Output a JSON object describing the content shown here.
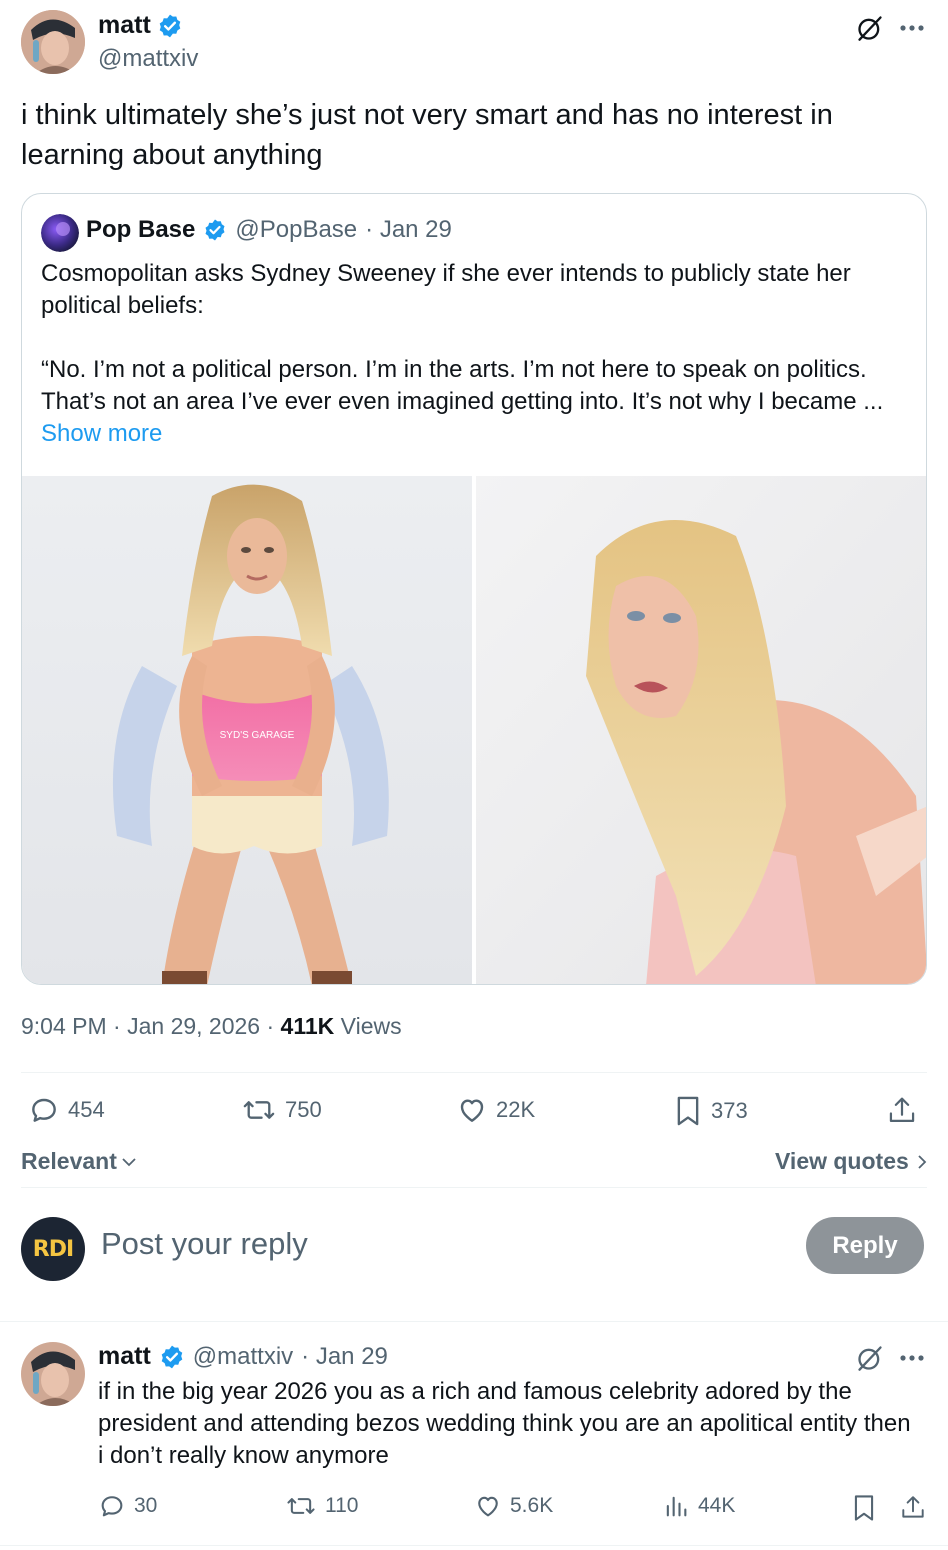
{
  "main_tweet": {
    "name": "matt",
    "handle": "@mattxiv",
    "text": "i think ultimately she’s just not very smart and has no interest in learning about anything",
    "timestamp": "9:04 PM · Jan 29, 2026 ·",
    "views_count": "411K",
    "views_label": "Views",
    "stats": {
      "replies": "454",
      "retweets": "750",
      "likes": "22K",
      "bookmarks": "373"
    }
  },
  "quoted_tweet": {
    "name": "Pop Base",
    "handle": "@PopBase",
    "date": "· Jan 29",
    "text_line1": "Cosmopolitan asks Sydney Sweeney if she ever intends to publicly state her political beliefs:",
    "text_line2": "“No. I’m not a political person. I’m in the arts. I’m not here to speak on politics. That’s not an area I’ve ever even imagined getting into. It’s not why I became ...",
    "show_more": "Show more",
    "left_photo_shirt_text": "SYD'S GARAGE"
  },
  "sort_bar": {
    "relevant": "Relevant",
    "view_quotes": "View quotes"
  },
  "composer": {
    "avatar_text": "RDI",
    "placeholder": "Post your reply",
    "reply_button": "Reply"
  },
  "reply_tweet": {
    "name": "matt",
    "handle": "@mattxiv",
    "date": "· Jan 29",
    "text": "if in the big year 2026 you as a rich and famous celebrity adored by the president and attending bezos wedding think you are an apolitical entity then i don’t really know anymore",
    "stats": {
      "replies": "30",
      "retweets": "110",
      "likes": "5.6K",
      "views": "44K"
    }
  },
  "colors": {
    "accent": "#1d9bf0",
    "text": "#0f1419",
    "secondary": "#536471",
    "border": "#cfd9de"
  }
}
